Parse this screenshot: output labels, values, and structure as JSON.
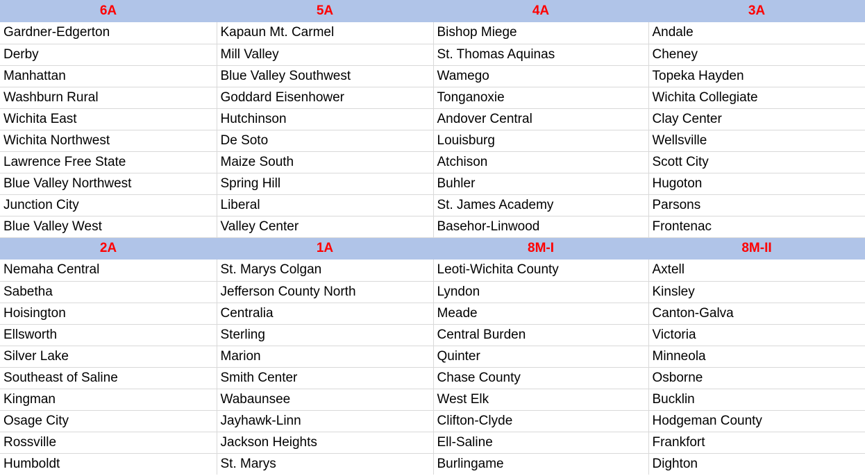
{
  "document": {
    "kind": "spreadsheet-table",
    "colors": {
      "header_background": "#b0c4e8",
      "header_text": "#ff0000",
      "cell_text": "#000000",
      "cell_background": "#ffffff",
      "gridline": "#d9d9d9"
    }
  },
  "sections": [
    {
      "id": "section-upper",
      "headers": [
        "6A",
        "5A",
        "4A",
        "3A"
      ],
      "rows": [
        [
          "Gardner-Edgerton",
          "Kapaun Mt. Carmel",
          "Bishop Miege",
          "Andale"
        ],
        [
          "Derby",
          "Mill Valley",
          "St. Thomas Aquinas",
          "Cheney"
        ],
        [
          "Manhattan",
          "Blue Valley Southwest",
          "Wamego",
          "Topeka Hayden"
        ],
        [
          "Washburn Rural",
          "Goddard Eisenhower",
          "Tonganoxie",
          "Wichita Collegiate"
        ],
        [
          "Wichita East",
          "Hutchinson",
          "Andover Central",
          "Clay Center"
        ],
        [
          "Wichita Northwest",
          "De Soto",
          "Louisburg",
          "Wellsville"
        ],
        [
          "Lawrence Free State",
          "Maize South",
          "Atchison",
          "Scott City"
        ],
        [
          "Blue Valley Northwest",
          "Spring Hill",
          "Buhler",
          "Hugoton"
        ],
        [
          "Junction City",
          "Liberal",
          "St. James Academy",
          "Parsons"
        ],
        [
          "Blue Valley West",
          "Valley Center",
          "Basehor-Linwood",
          "Frontenac"
        ]
      ]
    },
    {
      "id": "section-lower",
      "headers": [
        "2A",
        "1A",
        "8M-I",
        "8M-II"
      ],
      "rows": [
        [
          "Nemaha Central",
          "St. Marys Colgan",
          "Leoti-Wichita County",
          "Axtell"
        ],
        [
          "Sabetha",
          "Jefferson County North",
          "Lyndon",
          "Kinsley"
        ],
        [
          "Hoisington",
          "Centralia",
          "Meade",
          "Canton-Galva"
        ],
        [
          "Ellsworth",
          "Sterling",
          "Central Burden",
          "Victoria"
        ],
        [
          "Silver Lake",
          "Marion",
          "Quinter",
          "Minneola"
        ],
        [
          "Southeast of Saline",
          "Smith Center",
          "Chase County",
          "Osborne"
        ],
        [
          "Kingman",
          "Wabaunsee",
          "West Elk",
          "Bucklin"
        ],
        [
          "Osage City",
          "Jayhawk-Linn",
          "Clifton-Clyde",
          "Hodgeman County"
        ],
        [
          "Rossville",
          "Jackson Heights",
          "Ell-Saline",
          "Frankfort"
        ],
        [
          "Humboldt",
          "St. Marys",
          "Burlingame",
          "Dighton"
        ]
      ]
    }
  ]
}
